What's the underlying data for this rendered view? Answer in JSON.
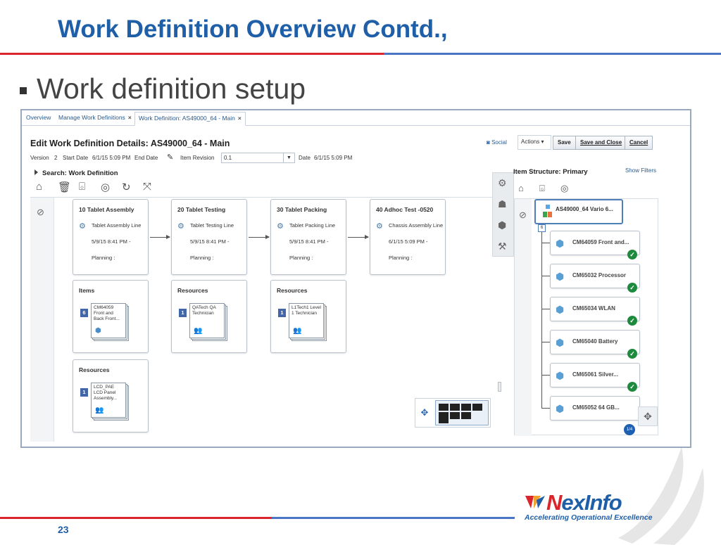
{
  "slide": {
    "title": "Work Definition Overview Contd.,",
    "bullet": "Work definition setup",
    "page_number": "23"
  },
  "logo": {
    "name_first": "N",
    "name_rest": "exInfo",
    "tagline": "Accelerating Operational Excellence"
  },
  "tabs": [
    {
      "label": "Overview"
    },
    {
      "label": "Manage Work Definitions"
    },
    {
      "label": "Work Definition: AS49000_64 - Main"
    }
  ],
  "header": {
    "title": "Edit Work Definition Details: AS49000_64 - Main",
    "version_label": "Version",
    "version_value": "2",
    "start_label": "Start Date",
    "start_value": "6/1/15 5:09 PM",
    "end_label": "End Date",
    "item_rev_label": "Item Revision",
    "item_rev_value": "0.1",
    "date_label": "Date",
    "date_value": "6/1/15 5:09 PM"
  },
  "toolbar": {
    "social": "Social",
    "actions": "Actions",
    "save": "Save",
    "save_close": "Save and Close",
    "cancel": "Cancel"
  },
  "search": {
    "label": "Search: Work Definition"
  },
  "operations": [
    {
      "title": "10 Tablet Assembly",
      "work_area": "Tablet Assembly Line",
      "date": "5/9/15 8:41 PM -",
      "planning": "Planning :"
    },
    {
      "title": "20 Tablet Testing",
      "work_area": "Tablet Testing Line",
      "date": "5/9/15 8:41 PM -",
      "planning": "Planning :"
    },
    {
      "title": "30 Tablet Packing",
      "work_area": "Tablet Packing Line",
      "date": "5/9/15 8:41 PM -",
      "planning": "Planning :"
    },
    {
      "title": "40 Adhoc Test -0520",
      "work_area": "Chassis Assembly Line",
      "date": "6/1/15 5:09 PM -",
      "planning": "Planning :"
    }
  ],
  "panels": [
    {
      "heading": "Items",
      "count": "6",
      "card_text": "CM64059 Front and Back Front..."
    },
    {
      "heading": "Resources",
      "count": "1",
      "card_text": "QATech QA Technician"
    },
    {
      "heading": "Resources",
      "count": "1",
      "card_text": "L1Tech1 Level 1 Technician"
    },
    {
      "heading": "Resources",
      "count": "1",
      "card_text": "LCD_PAE LCD Panel Assembly..."
    }
  ],
  "structure": {
    "title": "Item Structure: Primary",
    "show_filters": "Show Filters",
    "root": "AS49000_64 Vario 6...",
    "child_count": "6",
    "pager": "1/4",
    "nodes": [
      {
        "label": "CM64059 Front and..."
      },
      {
        "label": "CM65032 Processor"
      },
      {
        "label": "CM65034 WLAN"
      },
      {
        "label": "CM65040 Battery"
      },
      {
        "label": "CM65061 Silver..."
      },
      {
        "label": "CM65052 64 GB..."
      }
    ]
  },
  "colors": {
    "brand_blue": "#1f5fa8",
    "brand_red": "#d9252b",
    "badge_blue": "#4266a8",
    "ok_green": "#1e8a3e"
  }
}
